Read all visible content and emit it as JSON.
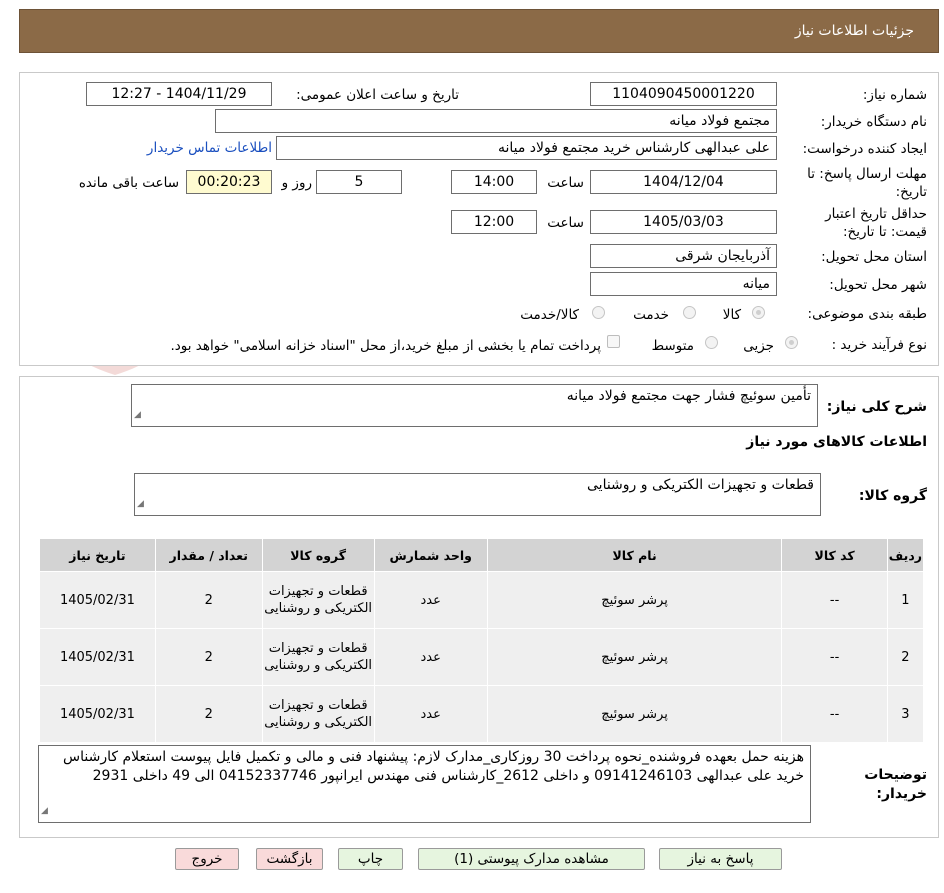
{
  "header": {
    "title": "جزئیات اطلاعات نیاز"
  },
  "watermark": {
    "text": "AriaTender.neT"
  },
  "form": {
    "need_number_label": "شماره نیاز:",
    "need_number": "1104090450001220",
    "announce_label": "تاریخ و ساعت اعلان عمومی:",
    "announce_value": "1404/11/29 - 12:27",
    "buyer_org_label": "نام دستگاه خریدار:",
    "buyer_org": "مجتمع فولاد میانه",
    "requester_label": "ایجاد کننده درخواست:",
    "requester": "علی عبدالهی کارشناس خرید مجتمع فولاد میانه",
    "contact_link": "اطلاعات تماس خریدار",
    "deadline_label_1": "مهلت ارسال پاسخ: تا",
    "deadline_label_2": "تاریخ:",
    "deadline_date": "1404/12/04",
    "time_label": "ساعت",
    "deadline_time": "14:00",
    "days_value": "5",
    "days_label": "روز و",
    "remaining_value": "00:20:23",
    "remaining_label": "ساعت باقی مانده",
    "validity_label_1": "حداقل تاریخ اعتبار",
    "validity_label_2": "قیمت: تا تاریخ:",
    "validity_date": "1405/03/03",
    "validity_time": "12:00",
    "province_label": "استان محل تحویل:",
    "province": "آذربایجان شرقی",
    "city_label": "شهر محل تحویل:",
    "city": "میانه",
    "category_label": "طبقه بندی موضوعی:",
    "category_options": [
      "کالا",
      "خدمت",
      "کالا/خدمت"
    ],
    "category_selected": "کالا",
    "process_label": "نوع فرآیند خرید :",
    "process_options": [
      "جزیی",
      "متوسط"
    ],
    "process_selected": "جزیی",
    "payment_note": "پرداخت تمام یا بخشی از مبلغ خرید،از محل \"اسناد خزانه اسلامی\" خواهد بود."
  },
  "summary": {
    "label": "شرح کلی نیاز:",
    "value": "تأمین سوئیچ فشار جهت مجتمع فولاد میانه",
    "goods_info_title": "اطلاعات کالاهای مورد نیاز",
    "goods_group_label": "گروه کالا:",
    "goods_group_value": "قطعات و تجهیزات الکتریکی و روشنایی"
  },
  "table": {
    "columns": [
      "ردیف",
      "کد کالا",
      "نام کالا",
      "واحد شمارش",
      "گروه کالا",
      "تعداد / مقدار",
      "تاریخ نیاز"
    ],
    "rows": [
      {
        "row": "1",
        "code": "--",
        "name": "پرشر سوئیچ",
        "unit": "عدد",
        "group": "قطعات و تجهیزات الکتریکی و روشنایی",
        "qty": "2",
        "date": "1405/02/31"
      },
      {
        "row": "2",
        "code": "--",
        "name": "پرشر سوئیچ",
        "unit": "عدد",
        "group": "قطعات و تجهیزات الکتریکی و روشنایی",
        "qty": "2",
        "date": "1405/02/31"
      },
      {
        "row": "3",
        "code": "--",
        "name": "پرشر سوئیچ",
        "unit": "عدد",
        "group": "قطعات و تجهیزات الکتریکی و روشنایی",
        "qty": "2",
        "date": "1405/02/31"
      }
    ]
  },
  "notes": {
    "label_1": "توضیحات",
    "label_2": "خریدار:",
    "value": "هزینه حمل بعهده فروشنده_نحوه پرداخت 30 روزکاری_مدارک لازم: پیشنهاد فنی و مالی و تکمیل فایل پیوست استعلام کارشناس خرید علی عبدالهی 09141246103 و داخلی 2612_کارشناس فنی مهندس ایرانپور 04152337746 الی 49 داخلی 2931"
  },
  "buttons": {
    "reply": "پاسخ به نیاز",
    "attachments": "مشاهده مدارک پیوستی (1)",
    "print": "چاپ",
    "back": "بازگشت",
    "exit": "خروج"
  }
}
